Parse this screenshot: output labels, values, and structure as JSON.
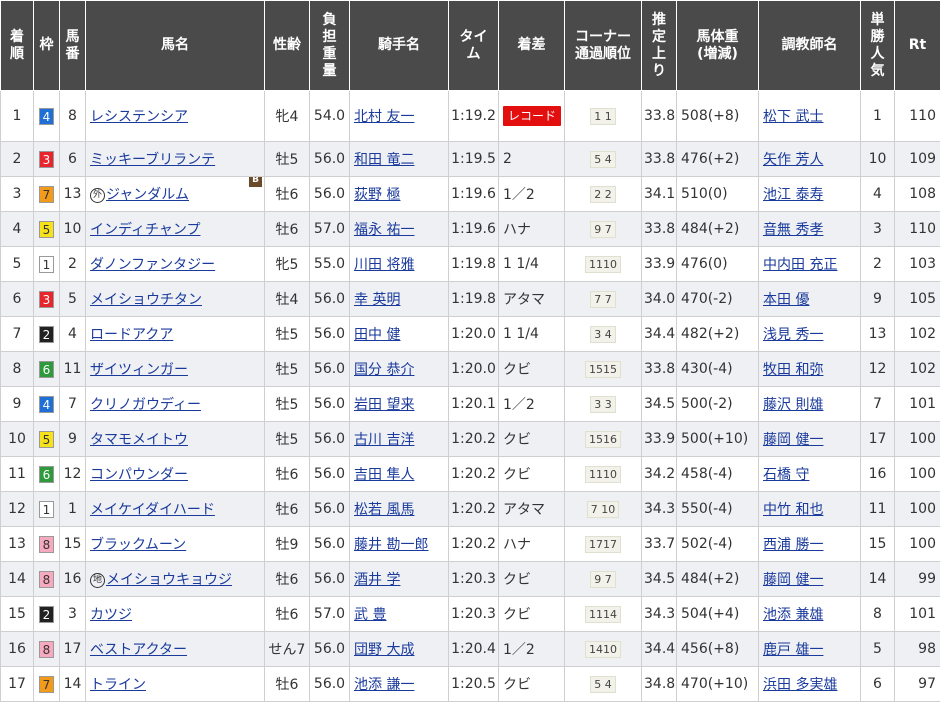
{
  "headers": {
    "rank": "着順",
    "waku": "枠",
    "umaban": "馬番",
    "horse": "馬名",
    "sexage": "性齢",
    "weight": "負担重量",
    "jockey": "騎手名",
    "time": "タイム",
    "margin": "着差",
    "corner": "コーナー通過順位",
    "last3f": "推定上り",
    "bodyweight": "馬体重(増減)",
    "trainer": "調教師名",
    "popularity": "単勝人気",
    "rating": "Rt"
  },
  "header_lines": {
    "rank": [
      "着",
      "順"
    ],
    "waku": [
      "枠"
    ],
    "umaban": [
      "馬",
      "番"
    ],
    "horse": [
      "馬名"
    ],
    "sexage": [
      "性齢"
    ],
    "weight": [
      "負",
      "担",
      "重",
      "量"
    ],
    "jockey": [
      "騎手名"
    ],
    "time": [
      "タイ",
      "ム"
    ],
    "margin": [
      "着差"
    ],
    "corner": [
      "コーナー",
      "通過順位"
    ],
    "last3f": [
      "推",
      "定",
      "上",
      "り"
    ],
    "bodyweight": [
      "馬体重",
      "(増減)"
    ],
    "trainer": [
      "調教師名"
    ],
    "popularity": [
      "単",
      "勝",
      "人",
      "気"
    ],
    "rating": [
      "Rt"
    ]
  },
  "waku_colors": {
    "1": {
      "bg": "#ffffff",
      "fg": "#333333"
    },
    "2": {
      "bg": "#222222",
      "fg": "#ffffff"
    },
    "3": {
      "bg": "#e8252c",
      "fg": "#ffffff"
    },
    "4": {
      "bg": "#1e6fd6",
      "fg": "#ffffff"
    },
    "5": {
      "bg": "#f5e21a",
      "fg": "#333333"
    },
    "6": {
      "bg": "#2f9a3c",
      "fg": "#ffffff"
    },
    "7": {
      "bg": "#f29a1a",
      "fg": "#333333"
    },
    "8": {
      "bg": "#f7a9c0",
      "fg": "#333333"
    }
  },
  "rows": [
    {
      "rank": "1",
      "waku": "4",
      "umaban": "8",
      "mark": "",
      "horse": "レシステンシア",
      "blinker": "",
      "sexage": "牝4",
      "weight": "54.0",
      "jockey": "北村 友一",
      "time": "1:19.2",
      "margin": "",
      "record": "レコード",
      "corner": "1 1",
      "last3f": "33.8",
      "bodyweight": "508(+8)",
      "trainer": "松下 武士",
      "popularity": "1",
      "rating": "110"
    },
    {
      "rank": "2",
      "waku": "3",
      "umaban": "6",
      "mark": "",
      "horse": "ミッキーブリランテ",
      "blinker": "",
      "sexage": "牡5",
      "weight": "56.0",
      "jockey": "和田 竜二",
      "time": "1:19.5",
      "margin": "2",
      "record": "",
      "corner": "5 4",
      "last3f": "33.8",
      "bodyweight": "476(+2)",
      "trainer": "矢作 芳人",
      "popularity": "10",
      "rating": "109"
    },
    {
      "rank": "3",
      "waku": "7",
      "umaban": "13",
      "mark": "外",
      "horse": "ジャンダルム",
      "blinker": "B",
      "sexage": "牡6",
      "weight": "56.0",
      "jockey": "荻野 極",
      "time": "1:19.6",
      "margin": "1／2",
      "record": "",
      "corner": "2 2",
      "last3f": "34.1",
      "bodyweight": "510(0)",
      "trainer": "池江 泰寿",
      "popularity": "4",
      "rating": "108"
    },
    {
      "rank": "4",
      "waku": "5",
      "umaban": "10",
      "mark": "",
      "horse": "インディチャンプ",
      "blinker": "",
      "sexage": "牡6",
      "weight": "57.0",
      "jockey": "福永 祐一",
      "time": "1:19.6",
      "margin": "ハナ",
      "record": "",
      "corner": "9 7",
      "last3f": "33.8",
      "bodyweight": "484(+2)",
      "trainer": "音無 秀孝",
      "popularity": "3",
      "rating": "110"
    },
    {
      "rank": "5",
      "waku": "1",
      "umaban": "2",
      "mark": "",
      "horse": "ダノンファンタジー",
      "blinker": "",
      "sexage": "牝5",
      "weight": "55.0",
      "jockey": "川田 将雅",
      "time": "1:19.8",
      "margin": "1 1/4",
      "record": "",
      "corner": "1110",
      "last3f": "33.9",
      "bodyweight": "476(0)",
      "trainer": "中内田 充正",
      "popularity": "2",
      "rating": "103"
    },
    {
      "rank": "6",
      "waku": "3",
      "umaban": "5",
      "mark": "",
      "horse": "メイショウチタン",
      "blinker": "",
      "sexage": "牡4",
      "weight": "56.0",
      "jockey": "幸 英明",
      "time": "1:19.8",
      "margin": "アタマ",
      "record": "",
      "corner": "7 7",
      "last3f": "34.0",
      "bodyweight": "470(-2)",
      "trainer": "本田 優",
      "popularity": "9",
      "rating": "105"
    },
    {
      "rank": "7",
      "waku": "2",
      "umaban": "4",
      "mark": "",
      "horse": "ロードアクア",
      "blinker": "",
      "sexage": "牡5",
      "weight": "56.0",
      "jockey": "田中 健",
      "time": "1:20.0",
      "margin": "1 1/4",
      "record": "",
      "corner": "3 4",
      "last3f": "34.4",
      "bodyweight": "482(+2)",
      "trainer": "浅見 秀一",
      "popularity": "13",
      "rating": "102"
    },
    {
      "rank": "8",
      "waku": "6",
      "umaban": "11",
      "mark": "",
      "horse": "ザイツィンガー",
      "blinker": "",
      "sexage": "牡5",
      "weight": "56.0",
      "jockey": "国分 恭介",
      "time": "1:20.0",
      "margin": "クビ",
      "record": "",
      "corner": "1515",
      "last3f": "33.8",
      "bodyweight": "430(-4)",
      "trainer": "牧田 和弥",
      "popularity": "12",
      "rating": "102"
    },
    {
      "rank": "9",
      "waku": "4",
      "umaban": "7",
      "mark": "",
      "horse": "クリノガウディー",
      "blinker": "",
      "sexage": "牡5",
      "weight": "56.0",
      "jockey": "岩田 望来",
      "time": "1:20.1",
      "margin": "1／2",
      "record": "",
      "corner": "3 3",
      "last3f": "34.5",
      "bodyweight": "500(-2)",
      "trainer": "藤沢 則雄",
      "popularity": "7",
      "rating": "101"
    },
    {
      "rank": "10",
      "waku": "5",
      "umaban": "9",
      "mark": "",
      "horse": "タマモメイトウ",
      "blinker": "",
      "sexage": "牡5",
      "weight": "56.0",
      "jockey": "古川 吉洋",
      "time": "1:20.2",
      "margin": "クビ",
      "record": "",
      "corner": "1516",
      "last3f": "33.9",
      "bodyweight": "500(+10)",
      "trainer": "藤岡 健一",
      "popularity": "17",
      "rating": "100"
    },
    {
      "rank": "11",
      "waku": "6",
      "umaban": "12",
      "mark": "",
      "horse": "コンパウンダー",
      "blinker": "",
      "sexage": "牡6",
      "weight": "56.0",
      "jockey": "吉田 隼人",
      "time": "1:20.2",
      "margin": "クビ",
      "record": "",
      "corner": "1110",
      "last3f": "34.2",
      "bodyweight": "458(-4)",
      "trainer": "石橋 守",
      "popularity": "16",
      "rating": "100"
    },
    {
      "rank": "12",
      "waku": "1",
      "umaban": "1",
      "mark": "",
      "horse": "メイケイダイハード",
      "blinker": "",
      "sexage": "牡6",
      "weight": "56.0",
      "jockey": "松若 風馬",
      "time": "1:20.2",
      "margin": "アタマ",
      "record": "",
      "corner": "7 10",
      "last3f": "34.3",
      "bodyweight": "550(-4)",
      "trainer": "中竹 和也",
      "popularity": "11",
      "rating": "100"
    },
    {
      "rank": "13",
      "waku": "8",
      "umaban": "15",
      "mark": "",
      "horse": "ブラックムーン",
      "blinker": "",
      "sexage": "牡9",
      "weight": "56.0",
      "jockey": "藤井 勘一郎",
      "time": "1:20.2",
      "margin": "ハナ",
      "record": "",
      "corner": "1717",
      "last3f": "33.7",
      "bodyweight": "502(-4)",
      "trainer": "西浦 勝一",
      "popularity": "15",
      "rating": "100"
    },
    {
      "rank": "14",
      "waku": "8",
      "umaban": "16",
      "mark": "地",
      "horse": "メイショウキョウジ",
      "blinker": "",
      "sexage": "牡6",
      "weight": "56.0",
      "jockey": "酒井 学",
      "time": "1:20.3",
      "margin": "クビ",
      "record": "",
      "corner": "9 7",
      "last3f": "34.5",
      "bodyweight": "484(+2)",
      "trainer": "藤岡 健一",
      "popularity": "14",
      "rating": "99"
    },
    {
      "rank": "15",
      "waku": "2",
      "umaban": "3",
      "mark": "",
      "horse": "カツジ",
      "blinker": "",
      "sexage": "牡6",
      "weight": "57.0",
      "jockey": "武 豊",
      "time": "1:20.3",
      "margin": "クビ",
      "record": "",
      "corner": "1114",
      "last3f": "34.3",
      "bodyweight": "504(+4)",
      "trainer": "池添 兼雄",
      "popularity": "8",
      "rating": "101"
    },
    {
      "rank": "16",
      "waku": "8",
      "umaban": "17",
      "mark": "",
      "horse": "ベストアクター",
      "blinker": "",
      "sexage": "せん7",
      "weight": "56.0",
      "jockey": "団野 大成",
      "time": "1:20.4",
      "margin": "1／2",
      "record": "",
      "corner": "1410",
      "last3f": "34.4",
      "bodyweight": "456(+8)",
      "trainer": "鹿戸 雄一",
      "popularity": "5",
      "rating": "98"
    },
    {
      "rank": "17",
      "waku": "7",
      "umaban": "14",
      "mark": "",
      "horse": "トライン",
      "blinker": "",
      "sexage": "牡6",
      "weight": "56.0",
      "jockey": "池添 謙一",
      "time": "1:20.5",
      "margin": "クビ",
      "record": "",
      "corner": "5 4",
      "last3f": "34.8",
      "bodyweight": "470(+10)",
      "trainer": "浜田 多実雄",
      "popularity": "6",
      "rating": "97"
    }
  ]
}
